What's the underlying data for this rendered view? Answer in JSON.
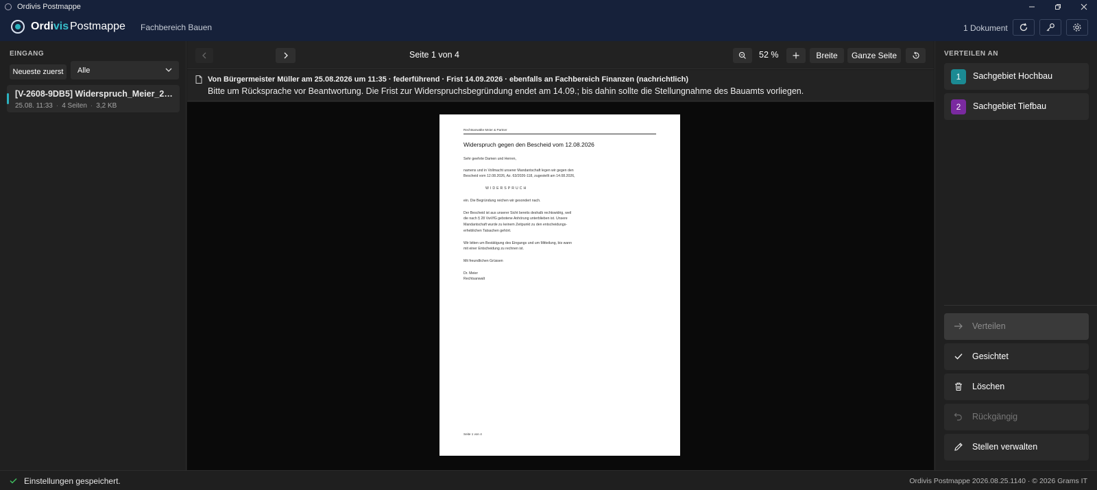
{
  "window": {
    "title": "Ordivis Postmappe",
    "controls": [
      "minimize-icon",
      "restore-icon",
      "close-icon"
    ]
  },
  "header": {
    "brand_a": "Ordi",
    "brand_b": "vis",
    "brand_c": "Postmappe",
    "department": "Fachbereich Bauen",
    "doc_count": "1 Dokument",
    "buttons": [
      "refresh-icon",
      "key-icon",
      "gear-icon"
    ]
  },
  "inbox": {
    "label": "EINGANG",
    "sort_label": "Neueste zuerst",
    "filter_value": "Alle",
    "items": [
      {
        "title": "[V-2608-9DB5] Widerspruch_Meier_2026.pdf",
        "date": "25.08. 11:33",
        "pages": "4 Seiten",
        "size": "3,2 KB"
      }
    ]
  },
  "toolbar": {
    "page_info": "Seite 1 von 4",
    "zoom": "52 %",
    "fit_width": "Breite",
    "fit_page": "Ganze Seite"
  },
  "note": {
    "header": "Von Bürgermeister Müller am 25.08.2026 um 11:35 · federführend · Frist 14.09.2026 · ebenfalls an Fachbereich Finanzen (nachrichtlich)",
    "text": "Bitte um Rücksprache vor Beantwortung. Die Frist zur Widerspruchsbegründung endet am 14.09.; bis dahin sollte die Stellungnahme des Bauamts vorliegen."
  },
  "document": {
    "firm": "Rechtsanwälte Meier & Partner",
    "heading": "Widerspruch gegen den Bescheid vom 12.08.2026",
    "salutation": "Sehr geehrte Damen und Herren,",
    "p1_l1": "namens und in Vollmacht unserer Mandantschaft legen wir gegen den",
    "p1_l2": "Bescheid vom 12.08.2026, Az. 63/2026-118, zugestellt am 14.08.2026,",
    "keyword": "WIDERSPRUCH",
    "p2": "ein. Die Begründung reichen wir gesondert nach.",
    "p3_l1": "Der Bescheid ist aus unserer Sicht bereits deshalb rechtswidrig, weil",
    "p3_l2": "die nach § 28 VwVfG gebotene Anhörung unterblieben ist. Unsere",
    "p3_l3": "Mandantschaft wurde zu keinem Zeitpunkt zu den entscheidungs-",
    "p3_l4": "erheblichen Tatsachen gehört.",
    "p4_l1": "Wir bitten um Bestätigung des Eingangs und um Mitteilung, bis wann",
    "p4_l2": "mit einer Entscheidung zu rechnen ist.",
    "closing": "Mit freundlichen Grüssen",
    "signer": "Dr. Meier",
    "signer_title": "Rechtsanwalt",
    "footer": "Seite 1 von 4"
  },
  "distribute": {
    "label": "VERTEILEN AN",
    "targets": [
      {
        "num": "1",
        "label": "Sachgebiet Hochbau",
        "color": "#1b8a93"
      },
      {
        "num": "2",
        "label": "Sachgebiet Tiefbau",
        "color": "#7a2aa0"
      }
    ]
  },
  "actions": {
    "distribute": "Verteilen",
    "seen": "Gesichtet",
    "delete": "Löschen",
    "undo": "Rückgängig",
    "manage": "Stellen verwalten"
  },
  "status": {
    "message": "Einstellungen gespeichert.",
    "version": "Ordivis Postmappe 2026.08.25.1140 · © 2026 Grams IT"
  },
  "colors": {
    "accent": "#2bb3c0",
    "header_bg": "#16213a",
    "success": "#3fbf5f"
  }
}
